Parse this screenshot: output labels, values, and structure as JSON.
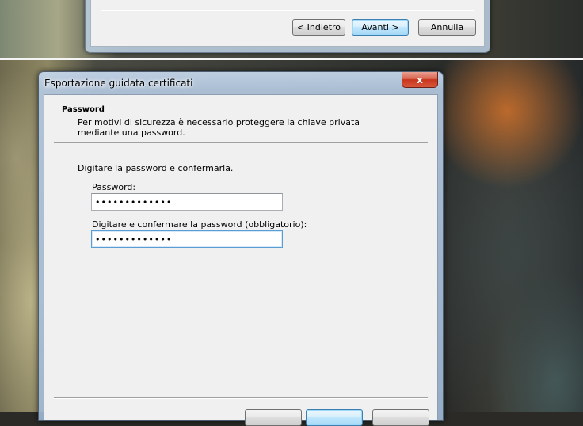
{
  "top_window": {
    "buttons": {
      "back": "< Indietro",
      "next": "Avanti >",
      "cancel": "Annulla"
    }
  },
  "dialog": {
    "title": "Esportazione guidata certificati",
    "close_glyph": "x",
    "header": {
      "title": "Password",
      "description": "Per motivi di sicurezza è necessario proteggere la chiave privata mediante una password."
    },
    "instructions": "Digitare la password e confermarla.",
    "password_label": "Password:",
    "password_value": "•••••••••••••",
    "confirm_label": "Digitare e confermare la password (obbligatorio):",
    "confirm_value": "•••••••••••••"
  },
  "colors": {
    "default_button_border": "#3c7fb1",
    "close_button": "#c7361d",
    "client_background": "#f0f0f0"
  }
}
